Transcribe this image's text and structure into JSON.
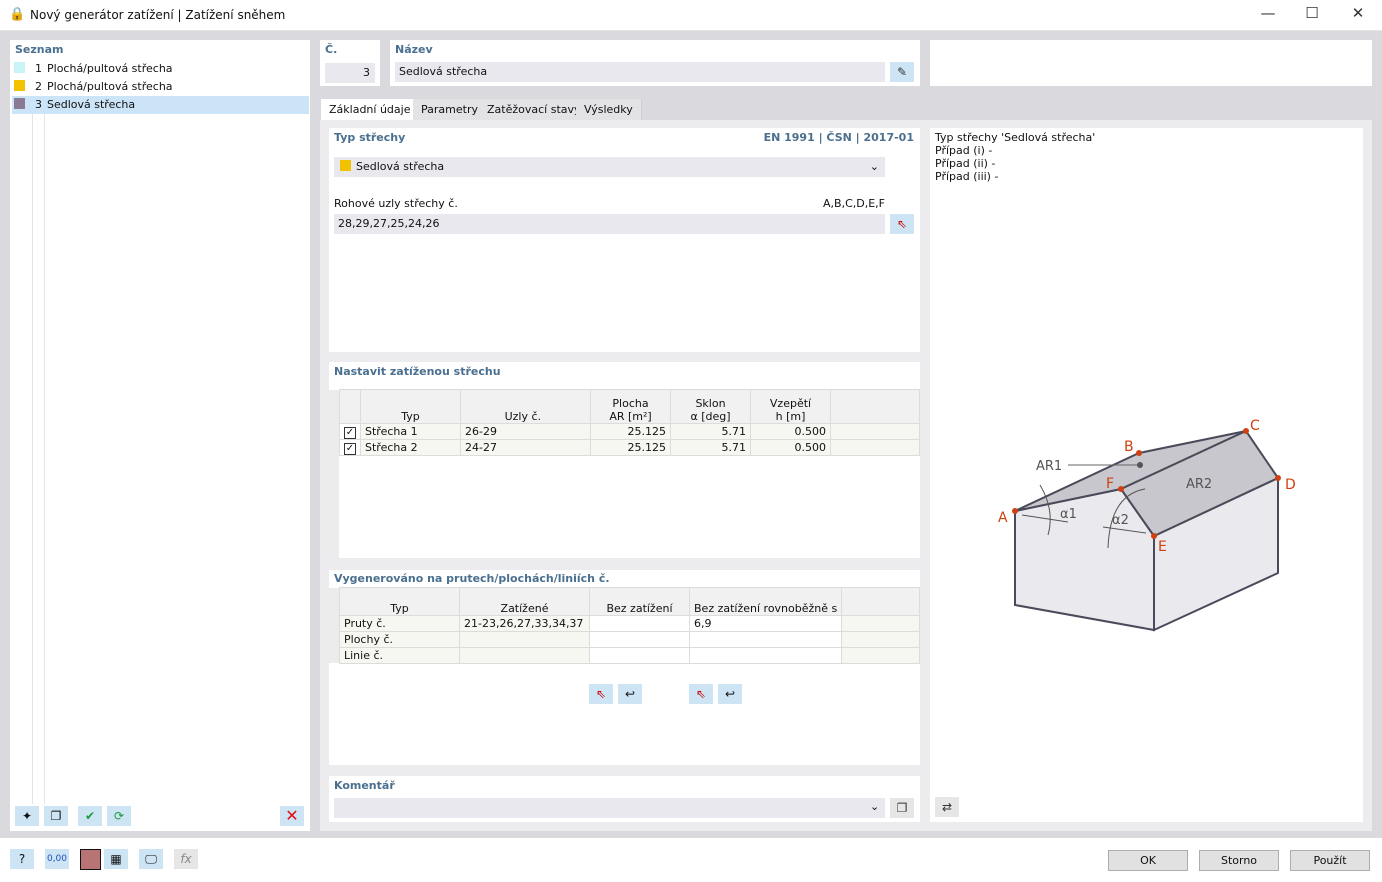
{
  "window": {
    "title": "Nový generátor zatížení | Zatížení sněhem",
    "minimize": "—",
    "maximize": "☐",
    "close": "✕"
  },
  "list": {
    "header": "Seznam",
    "items": [
      {
        "num": "1",
        "label": "Plochá/pultová střecha",
        "color": "#c9f4f7"
      },
      {
        "num": "2",
        "label": "Plochá/pultová střecha",
        "color": "#f2c200"
      },
      {
        "num": "3",
        "label": "Sedlová střecha",
        "color": "#8a7a96",
        "selected": true
      }
    ]
  },
  "number": {
    "label": "Č.",
    "value": "3"
  },
  "name": {
    "label": "Název",
    "value": "Sedlová střecha"
  },
  "tabs": [
    "Základní údaje",
    "Parametry",
    "Zatěžovací stavy",
    "Výsledky"
  ],
  "roof_type": {
    "header": "Typ střechy",
    "standard": "EN 1991 | ČSN | 2017-01",
    "selected": "Sedlová střecha",
    "color": "#f2c200",
    "corner_label": "Rohové uzly střechy č.",
    "corner_hint": "A,B,C,D,E,F",
    "corner_value": "28,29,27,25,24,26"
  },
  "loaded_roof": {
    "header": "Nastavit zatíženou střechu",
    "columns": [
      [
        "",
        "Typ"
      ],
      [
        "",
        "Uzly č."
      ],
      [
        "Plocha",
        "AR [m²]"
      ],
      [
        "Sklon",
        "α [deg]"
      ],
      [
        "Vzepětí",
        "h [m]"
      ]
    ],
    "rows": [
      {
        "checked": true,
        "typ": "Střecha 1",
        "uzly": "26-29",
        "plocha": "25.125",
        "sklon": "5.71",
        "h": "0.500"
      },
      {
        "checked": true,
        "typ": "Střecha 2",
        "uzly": "24-27",
        "plocha": "25.125",
        "sklon": "5.71",
        "h": "0.500"
      }
    ]
  },
  "generated": {
    "header": "Vygenerováno na prutech/plochách/liniích č.",
    "columns": [
      "Typ",
      "Zatížené",
      "Bez zatížení",
      "Bez zatížení rovnoběžně s"
    ],
    "rows": [
      [
        "Pruty č.",
        "21-23,26,27,33,34,37",
        "",
        "6,9"
      ],
      [
        "Plochy č.",
        "",
        "",
        ""
      ],
      [
        "Linie č.",
        "",
        "",
        ""
      ]
    ]
  },
  "comment": {
    "header": "Komentář",
    "value": ""
  },
  "info": {
    "lines": [
      "Typ střechy 'Sedlová střecha'",
      "Případ (i) -",
      "Případ (ii) -",
      "Případ (iii) -"
    ]
  },
  "diagram": {
    "labels": {
      "A": "A",
      "B": "B",
      "C": "C",
      "D": "D",
      "E": "E",
      "F": "F",
      "AR1": "AR1",
      "AR2": "AR2",
      "a1": "α1",
      "a2": "α2"
    },
    "accent": "#d04010"
  },
  "footer": {
    "ok": "OK",
    "cancel": "Storno",
    "apply": "Použít",
    "decimals": "0,00"
  }
}
